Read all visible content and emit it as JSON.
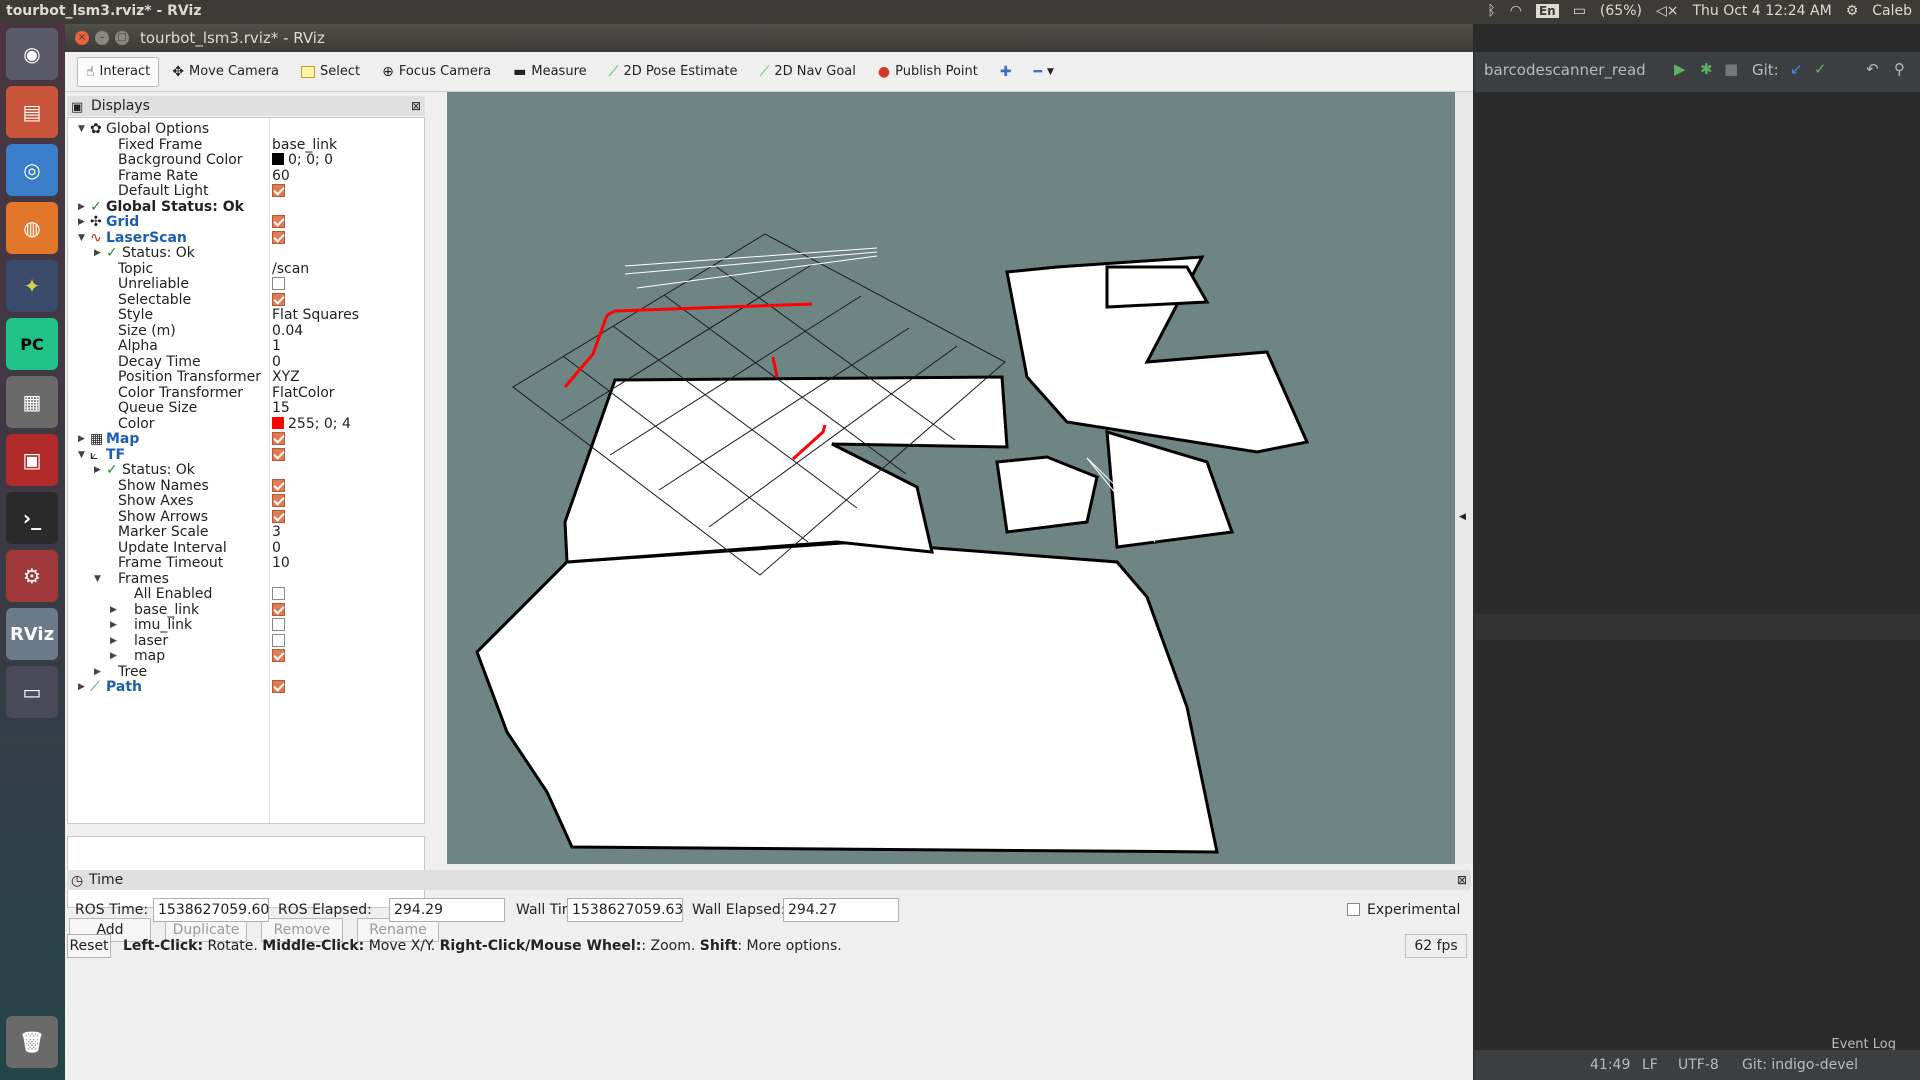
{
  "top_panel": {
    "title": "tourbot_lsm3.rviz* - RViz",
    "keyboard": "En",
    "battery": "(65%)",
    "clock": "Thu Oct  4 12:24 AM",
    "user": "Caleb"
  },
  "window": {
    "title": "tourbot_lsm3.rviz* - RViz"
  },
  "toolbar": {
    "interact": "Interact",
    "move_camera": "Move Camera",
    "select": "Select",
    "focus_camera": "Focus Camera",
    "measure": "Measure",
    "pose_estimate": "2D Pose Estimate",
    "nav_goal": "2D Nav Goal",
    "publish_point": "Publish Point"
  },
  "displays": {
    "title": "Displays",
    "rows": [
      {
        "label": "Global Options",
        "value": ""
      },
      {
        "label": "Fixed Frame",
        "value": "base_link"
      },
      {
        "label": "Background Color",
        "value": "0; 0; 0"
      },
      {
        "label": "Frame Rate",
        "value": "60"
      },
      {
        "label": "Default Light",
        "value": ""
      },
      {
        "label": "Global Status: Ok",
        "value": ""
      },
      {
        "label": "Grid",
        "value": ""
      },
      {
        "label": "LaserScan",
        "value": ""
      },
      {
        "label": "Status: Ok",
        "value": ""
      },
      {
        "label": "Topic",
        "value": "/scan"
      },
      {
        "label": "Unreliable",
        "value": ""
      },
      {
        "label": "Selectable",
        "value": ""
      },
      {
        "label": "Style",
        "value": "Flat Squares"
      },
      {
        "label": "Size (m)",
        "value": "0.04"
      },
      {
        "label": "Alpha",
        "value": "1"
      },
      {
        "label": "Decay Time",
        "value": "0"
      },
      {
        "label": "Position Transformer",
        "value": "XYZ"
      },
      {
        "label": "Color Transformer",
        "value": "FlatColor"
      },
      {
        "label": "Queue Size",
        "value": "15"
      },
      {
        "label": "Color",
        "value": "255; 0; 4"
      },
      {
        "label": "Map",
        "value": ""
      },
      {
        "label": "TF",
        "value": ""
      },
      {
        "label": "Status: Ok",
        "value": ""
      },
      {
        "label": "Show Names",
        "value": ""
      },
      {
        "label": "Show Axes",
        "value": ""
      },
      {
        "label": "Show Arrows",
        "value": ""
      },
      {
        "label": "Marker Scale",
        "value": "3"
      },
      {
        "label": "Update Interval",
        "value": "0"
      },
      {
        "label": "Frame Timeout",
        "value": "10"
      },
      {
        "label": "Frames",
        "value": ""
      },
      {
        "label": "All Enabled",
        "value": ""
      },
      {
        "label": "base_link",
        "value": ""
      },
      {
        "label": "imu_link",
        "value": ""
      },
      {
        "label": "laser",
        "value": ""
      },
      {
        "label": "map",
        "value": ""
      },
      {
        "label": "Tree",
        "value": ""
      },
      {
        "label": "Path",
        "value": ""
      }
    ],
    "buttons": {
      "add": "Add",
      "duplicate": "Duplicate",
      "remove": "Remove",
      "rename": "Rename"
    }
  },
  "time_panel": {
    "title": "Time",
    "ros_time_label": "ROS Time:",
    "ros_time": "1538627059.60",
    "ros_elapsed_label": "ROS Elapsed:",
    "ros_elapsed": "294.29",
    "wall_time_label": "Wall Time:",
    "wall_time": "1538627059.63",
    "wall_elapsed_label": "Wall Elapsed:",
    "wall_elapsed": "294.27",
    "experimental": "Experimental"
  },
  "status_bar": {
    "reset": "Reset",
    "hint_left_click": "Left-Click:",
    "hint_left_action": " Rotate. ",
    "hint_middle_click": "Middle-Click:",
    "hint_middle_action": " Move X/Y. ",
    "hint_right_click": "Right-Click/Mouse Wheel:",
    "hint_right_action": ": Zoom. ",
    "hint_shift": "Shift",
    "hint_shift_action": ": More options.",
    "fps": "62 fps"
  },
  "ide": {
    "run_config": "barcodescanner_read",
    "git_label": "Git:",
    "event_log": "Event Log",
    "position": "41:49",
    "line_sep": "LF",
    "encoding": "UTF-8",
    "branch": "Git: indigo-devel"
  },
  "colors": {
    "viewport_bg": "#6f8584",
    "laser": "#ff0004",
    "checkbox_on": "#e07b53"
  }
}
